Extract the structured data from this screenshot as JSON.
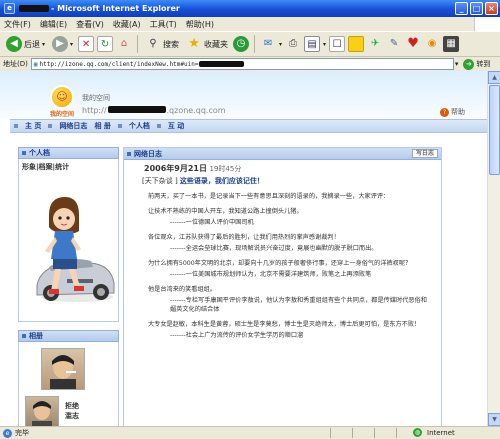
{
  "window": {
    "title": "- Microsoft Internet Explorer"
  },
  "menu": [
    "文件(F)",
    "编辑(E)",
    "查看(V)",
    "收藏(A)",
    "工具(T)",
    "帮助(H)"
  ],
  "toolbar": {
    "back_label": "后退",
    "search_label": "搜索",
    "favorites_label": "收藏夹"
  },
  "address": {
    "label": "地址(D)",
    "url": "http://izone.qq.com/client/indexNew.htm#uin=",
    "go_label": "转到"
  },
  "space": {
    "logo_text": "我的空间",
    "name": "我的空间",
    "url_prefix": "http://",
    "url_suffix": ".qzone.qq.com",
    "help_label": "帮助"
  },
  "nav": [
    "主 页",
    "网络日志",
    "相 册",
    "个人档",
    "互 动"
  ],
  "profile": {
    "header": "个人档",
    "links": "形象|档案|统计"
  },
  "album": {
    "header": "相册",
    "thumb_label_1": "拒绝",
    "thumb_label_2": "滥志"
  },
  "blog": {
    "header": "网络日志",
    "more_label": "写日志",
    "date": "2006年9月21日",
    "time": "19时45分",
    "title_prefix": "[天下杂谈 ]",
    "title": "这些语录，我们应该记住！",
    "paragraphs": [
      "前两天，买了一本书，是记录当下一些有意思且深刻的语录的，我摘录一些，大家评评：",
      "让技术不熟练的中国人开车，我知道公路上撞倒头儿猪。",
      "-------一位德国人评价中国司机",
      "各位观众，江苏队获得了最后的胜利，让我们用热烈的掌声感谢裁判！",
      "-------全运会垒球比赛，现场解说员兴奋过度，竟展也幽默的脱子脱口而出。",
      "为什么拥有5000年文明的北京，却要向十几岁的孩子般奢侈行事，还穿上一身俗气的洋裤衩呢？",
      "-------一位美国城市规划师认为，北京不需要洋建筑师，败笔之上再添败笔",
      "他是台湾来的笑看组组。",
      "-------专栏写手康国平评价李敖说，他认为李敖和秀重组组有些个共同点，都是传媒时代恶俗和媚英文化的结合体",
      "大专女是赵敏，本科生是黄蓉，硕士生是李莫愁，博士生是灭绝师太，博士后更可怕，是东方不败！",
      "-------社会上广为流传的评价女学生学历的顺口溜"
    ]
  },
  "status": {
    "text": "完毕",
    "zone": "Internet"
  }
}
